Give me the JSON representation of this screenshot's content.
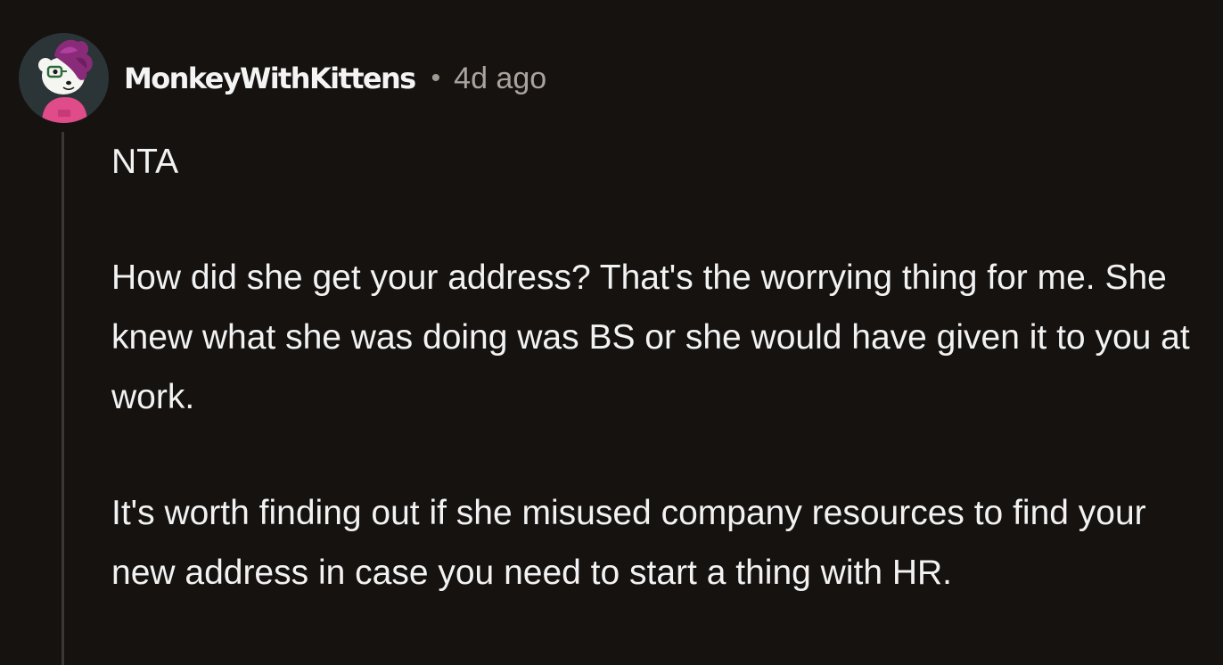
{
  "comment": {
    "author": "MonkeyWithKittens",
    "separator": "•",
    "timestamp": "4d ago",
    "avatar_icon": "cartoon-avatar-icon",
    "paragraphs": [
      "NTA",
      "How did she get your address? That's the worrying thing for me. She knew what she was doing was BS or she would have given it to you at work.",
      "It's worth finding out if she misused company resources to find your new address in case you need to start a thing with HR."
    ]
  },
  "colors": {
    "background": "#151210",
    "text": "#f2f2f2",
    "meta_text": "#aaa39d",
    "thread_line": "#3b3734",
    "avatar_hair": "#8a2b7a",
    "avatar_shirt": "#e04b8a"
  }
}
